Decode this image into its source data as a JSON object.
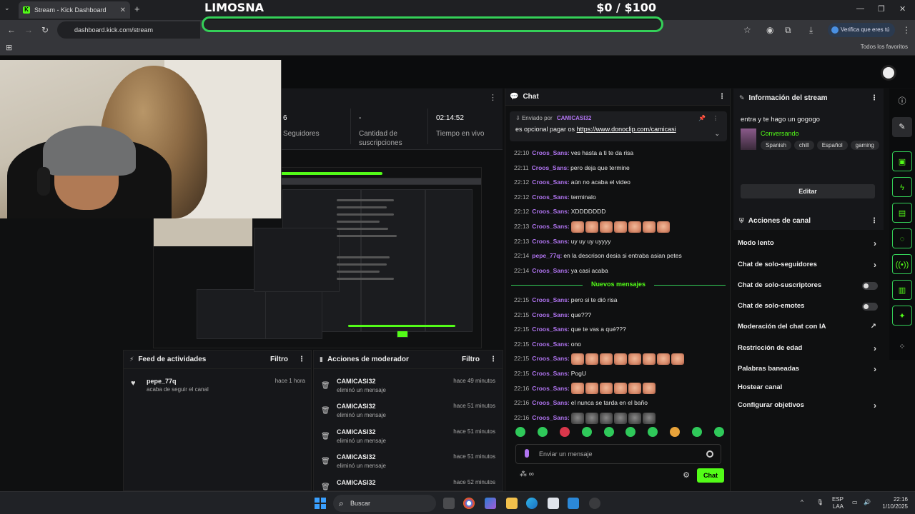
{
  "browser": {
    "tab_title": "Stream - Kick Dashboard",
    "tab_favicon": "K",
    "url": "dashboard.kick.com/stream",
    "verify_label": "Verifica que eres tú",
    "bookmarks_label": "Todos los favoritos"
  },
  "donation_overlay": {
    "label": "LIMOSNA",
    "amount": "$0  / $100",
    "progress": 0,
    "color": "#34d058"
  },
  "stats": {
    "followers_value": "6",
    "followers_label": "Seguidores",
    "subs_value": "-",
    "subs_label": "Cantidad de suscripciones",
    "live_time_value": "02:14:52",
    "live_time_label": "Tiempo en vivo"
  },
  "activity_feed": {
    "title": "Feed de actividades",
    "filter_label": "Filtro",
    "items": [
      {
        "user": "pepe_77q",
        "desc": "acaba de seguir el canal",
        "time": "hace 1 hora"
      }
    ]
  },
  "mod_actions": {
    "title": "Acciones de moderador",
    "filter_label": "Filtro",
    "items": [
      {
        "user": "CAMICASI32",
        "desc": "eliminó un mensaje",
        "time": "hace 49 minutos"
      },
      {
        "user": "CAMICASI32",
        "desc": "eliminó un mensaje",
        "time": "hace 51 minutos"
      },
      {
        "user": "CAMICASI32",
        "desc": "eliminó un mensaje",
        "time": "hace 51 minutos"
      },
      {
        "user": "CAMICASI32",
        "desc": "eliminó un mensaje",
        "time": "hace 51 minutos"
      },
      {
        "user": "CAMICASI32",
        "desc": "",
        "time": "hace 52 minutos"
      }
    ]
  },
  "chat": {
    "title": "Chat",
    "pinned_by_label": "Enviado por",
    "pinned_by_user": "CAMICASI32",
    "pinned_text": "es opcional pagar os",
    "pinned_link": "https://www.donoclip.com/camicasi",
    "username_color": "#b074f0",
    "messages": [
      {
        "time": "22:10",
        "user": "Croos_Sans:",
        "text": "ves hasta a ti te da risa",
        "emotes": 0
      },
      {
        "time": "22:11",
        "user": "Croos_Sans:",
        "text": "pero deja que termine",
        "emotes": 0
      },
      {
        "time": "22:12",
        "user": "Croos_Sans:",
        "text": "aún no acaba el video",
        "emotes": 0
      },
      {
        "time": "22:12",
        "user": "Croos_Sans:",
        "text": "terminalo",
        "emotes": 0
      },
      {
        "time": "22:12",
        "user": "Croos_Sans:",
        "text": "XDDDDDDD",
        "emotes": 0
      },
      {
        "time": "22:13",
        "user": "Croos_Sans:",
        "text": "",
        "emotes": 7
      },
      {
        "time": "22:13",
        "user": "Croos_Sans:",
        "text": "uy uy uy uyyyy",
        "emotes": 0
      },
      {
        "time": "22:14",
        "user": "pepe_77q:",
        "text": "en la descrison desia si entraba asian petes",
        "emotes": 0
      },
      {
        "time": "22:14",
        "user": "Croos_Sans:",
        "text": "ya casi acaba",
        "emotes": 0
      }
    ],
    "new_messages_label": "Nuevos mensajes",
    "new_messages": [
      {
        "time": "22:15",
        "user": "Croos_Sans:",
        "text": "pero si te dió risa",
        "emotes": 0
      },
      {
        "time": "22:15",
        "user": "Croos_Sans:",
        "text": "que???",
        "emotes": 0
      },
      {
        "time": "22:15",
        "user": "Croos_Sans:",
        "text": "que te vas a qué???",
        "emotes": 0
      },
      {
        "time": "22:15",
        "user": "Croos_Sans:",
        "text": "ono",
        "emotes": 0
      },
      {
        "time": "22:15",
        "user": "Croos_Sans:",
        "text": "",
        "emotes": 8
      },
      {
        "time": "22:15",
        "user": "Croos_Sans:",
        "text": "PogU",
        "emotes": 0
      },
      {
        "time": "22:16",
        "user": "Croos_Sans:",
        "text": "",
        "emotes": 6
      },
      {
        "time": "22:16",
        "user": "Croos_Sans:",
        "text": "el nunca se tarda en el baño",
        "emotes": 0
      },
      {
        "time": "22:16",
        "user": "Croos_Sans:",
        "text": "",
        "emotes": 6,
        "grey": true
      }
    ],
    "input_placeholder": "Enviar un mensaje",
    "send_label": "Chat"
  },
  "stream_info": {
    "panel_title": "Información del stream",
    "title": "entra y te hago un gogogo",
    "category": "Conversando",
    "tags": [
      "Spanish",
      "chill",
      "Español",
      "gaming"
    ],
    "edit_label": "Editar"
  },
  "channel_actions": {
    "title": "Acciones de canal",
    "items": [
      {
        "label": "Modo lento",
        "kind": "arrow"
      },
      {
        "label": "Chat de solo-seguidores",
        "kind": "arrow"
      },
      {
        "label": "Chat de solo-suscriptores",
        "kind": "toggle"
      },
      {
        "label": "Chat de solo-emotes",
        "kind": "toggle"
      },
      {
        "label": "Moderación del chat con IA",
        "kind": "external"
      },
      {
        "label": "Restricción de edad",
        "kind": "arrow"
      },
      {
        "label": "Palabras baneadas",
        "kind": "arrow"
      },
      {
        "label": "Hostear canal",
        "kind": "none"
      },
      {
        "label": "Configurar objetivos",
        "kind": "arrow"
      }
    ]
  },
  "taskbar": {
    "search_label": "Buscar",
    "lang_top": "ESP",
    "lang_bottom": "LAA",
    "time": "22:16",
    "date": "1/10/2025"
  },
  "colors": {
    "kick_green": "#53fc18",
    "panel_bg": "#16171a"
  }
}
